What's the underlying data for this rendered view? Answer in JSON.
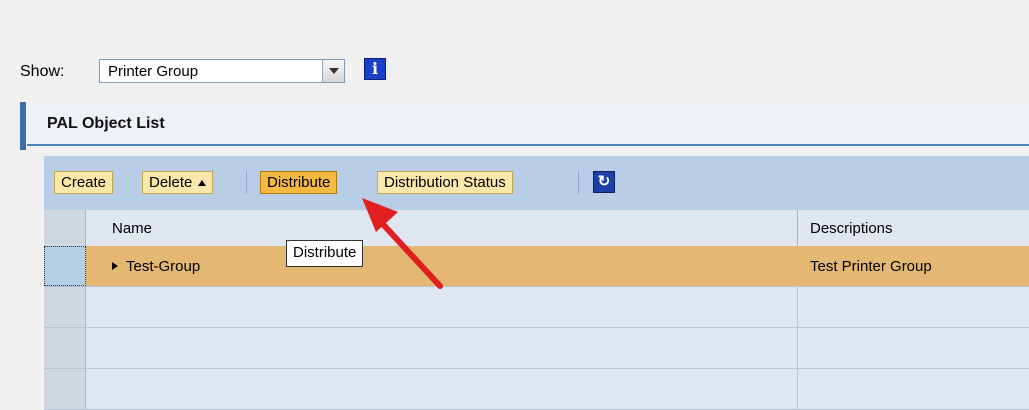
{
  "filter": {
    "show_label": "Show:",
    "selected_value": "Printer Group"
  },
  "icons": {
    "info": "info-icon",
    "refresh": "refresh-icon"
  },
  "panel": {
    "title": "PAL Object List"
  },
  "toolbar": {
    "create_label": "Create",
    "delete_label": "Delete",
    "distribute_label": "Distribute",
    "distribution_status_label": "Distribution Status"
  },
  "table": {
    "columns": [
      "Name",
      "Descriptions"
    ],
    "rows": [
      {
        "name": "Test-Group",
        "description": "Test Printer Group",
        "selected": true
      },
      {
        "name": "",
        "description": "",
        "selected": false
      },
      {
        "name": "",
        "description": "",
        "selected": false
      }
    ]
  },
  "tooltip": {
    "text": "Distribute"
  },
  "colors": {
    "toolbar_bg": "#b8cde6",
    "button_bg": "#fbe7aa",
    "button_active_bg": "#f5b840",
    "selected_row_bg": "#e4b872",
    "annotation_arrow": "#e02020"
  }
}
